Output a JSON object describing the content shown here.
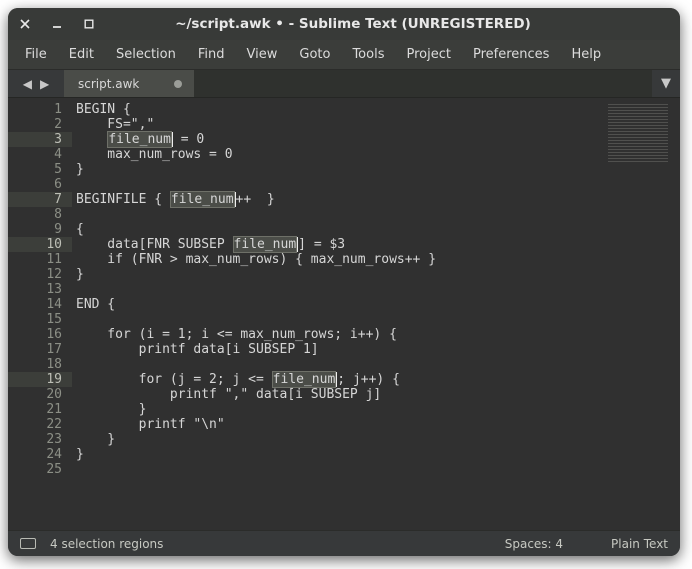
{
  "window": {
    "title": "~/script.awk • - Sublime Text (UNREGISTERED)"
  },
  "menu": {
    "items": [
      "File",
      "Edit",
      "Selection",
      "Find",
      "View",
      "Goto",
      "Tools",
      "Project",
      "Preferences",
      "Help"
    ]
  },
  "tabs": {
    "active": {
      "label": "script.awk",
      "dirty": true
    }
  },
  "editor": {
    "total_lines": 25,
    "selected_line_numbers": [
      3,
      7,
      10,
      19
    ],
    "highlight_text": "file_num",
    "lines": [
      "BEGIN {",
      "    FS=\",\"",
      "    file_num = 0",
      "    max_num_rows = 0",
      "}",
      "",
      "BEGINFILE { file_num++  }",
      "",
      "{",
      "    data[FNR SUBSEP file_num] = $3",
      "    if (FNR > max_num_rows) { max_num_rows++ }",
      "}",
      "",
      "END {",
      "",
      "    for (i = 1; i <= max_num_rows; i++) {",
      "        printf data[i SUBSEP 1]",
      "",
      "        for (j = 2; j <= file_num; j++) {",
      "            printf \",\" data[i SUBSEP j]",
      "        }",
      "        printf \"\\n\"",
      "    }",
      "}",
      ""
    ]
  },
  "status": {
    "selection": "4 selection regions",
    "spaces": "Spaces: 4",
    "syntax": "Plain Text"
  }
}
